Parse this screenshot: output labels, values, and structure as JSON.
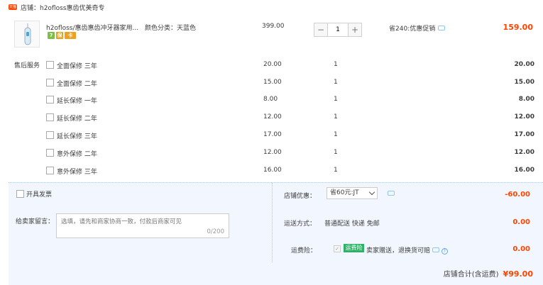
{
  "store": {
    "tag": "天猫",
    "label": "店铺：h2ofloss惠齿优美奇专"
  },
  "item": {
    "name": "h2ofloss/惠齿惠齿冲牙器家用...",
    "badges": [
      "7",
      "保",
      "卡"
    ],
    "sku": "颜色分类：天蓝色",
    "price": "399.00",
    "qty": "1",
    "qty_minus": "−",
    "qty_plus": "+",
    "promo": "省240:优惠促销",
    "subtotal": "159.00"
  },
  "services": {
    "label": "售后服务",
    "items": [
      {
        "name": "全面保修 三年",
        "price": "20.00",
        "qty": "1",
        "total": "20.00"
      },
      {
        "name": "全面保修 二年",
        "price": "15.00",
        "qty": "1",
        "total": "15.00"
      },
      {
        "name": "延长保修 一年",
        "price": "8.00",
        "qty": "1",
        "total": "8.00"
      },
      {
        "name": "延长保修 二年",
        "price": "12.00",
        "qty": "1",
        "total": "12.00"
      },
      {
        "name": "延长保修 三年",
        "price": "17.00",
        "qty": "1",
        "total": "17.00"
      },
      {
        "name": "意外保修 二年",
        "price": "12.00",
        "qty": "1",
        "total": "12.00"
      },
      {
        "name": "意外保修 三年",
        "price": "16.00",
        "qty": "1",
        "total": "16.00"
      }
    ]
  },
  "invoice": {
    "label": "开具发票"
  },
  "message": {
    "label": "给卖家留言：",
    "placeholder": "选填，请先和商家协商一致，付款后商家可见",
    "count": "0/200"
  },
  "coupon": {
    "label": "店铺优惠：",
    "selected": "省60元:JT",
    "amount": "-60.00"
  },
  "shipping": {
    "label": "运送方式：",
    "value": "普通配送 快递 免邮",
    "amount": "0.00"
  },
  "insurance": {
    "label": "运费险：",
    "tag": "运费险",
    "text": "卖家赠送，退换货可赔",
    "amount": "0.00"
  },
  "total": {
    "label": "店铺合计(含运费)",
    "value": "¥99.00"
  },
  "colors": {
    "accent": "#ff4400",
    "panel": "#f2f7ff",
    "insurance": "#2eb067"
  }
}
